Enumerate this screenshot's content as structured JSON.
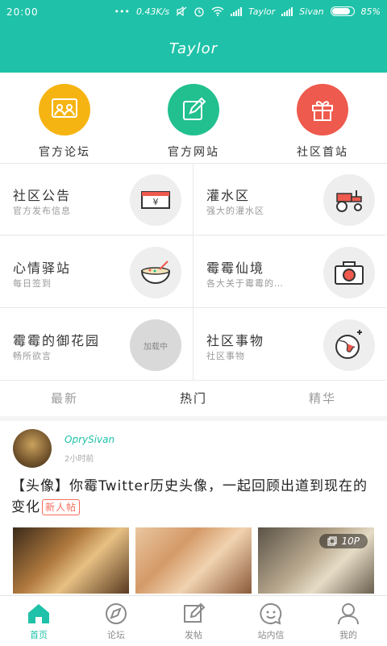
{
  "status_bar": {
    "time": "20:00",
    "speed": "0.43K/s",
    "carrier1": "Taylor",
    "carrier2": "Sivan",
    "battery": "85%",
    "battery_level": 0.85
  },
  "app": {
    "title": "Taylor",
    "accent_color": "#1fc2a8"
  },
  "quick_links": [
    {
      "label": "官方论坛",
      "icon": "presentation-icon",
      "color": "#f6b412"
    },
    {
      "label": "官方网站",
      "icon": "edit-icon",
      "color": "#21c08e"
    },
    {
      "label": "社区首站",
      "icon": "gift-icon",
      "color": "#ee5a4d"
    }
  ],
  "sections": [
    {
      "title": "社区公告",
      "subtitle": "官方发布信息",
      "icon": "ticket-icon"
    },
    {
      "title": "灌水区",
      "subtitle": "强大的灌水区",
      "icon": "tractor-icon"
    },
    {
      "title": "心情驿站",
      "subtitle": "每日签到",
      "icon": "bowl-icon"
    },
    {
      "title": "霉霉仙境",
      "subtitle": "各大关于霉霉的…",
      "icon": "camera-icon"
    },
    {
      "title": "霉霉的御花园",
      "subtitle": "畅所欲言",
      "icon_text": "加载中"
    },
    {
      "title": "社区事物",
      "subtitle": "社区事物",
      "icon": "globe-icon"
    }
  ],
  "tabs": [
    {
      "label": "最新"
    },
    {
      "label": "热门",
      "active": true
    },
    {
      "label": "精华"
    }
  ],
  "post": {
    "username": "OprySivan",
    "time": "2小时前",
    "title": "【头像】你霉Twitter历史头像，一起回顾出道到现在的变化",
    "badge": "新人帖",
    "photo_count": "10P"
  },
  "bottom_nav": [
    {
      "label": "首页",
      "icon": "home-icon",
      "active": true
    },
    {
      "label": "论坛",
      "icon": "compass-icon"
    },
    {
      "label": "发帖",
      "icon": "compose-icon"
    },
    {
      "label": "站内信",
      "icon": "smiley-icon"
    },
    {
      "label": "我的",
      "icon": "user-icon"
    }
  ]
}
